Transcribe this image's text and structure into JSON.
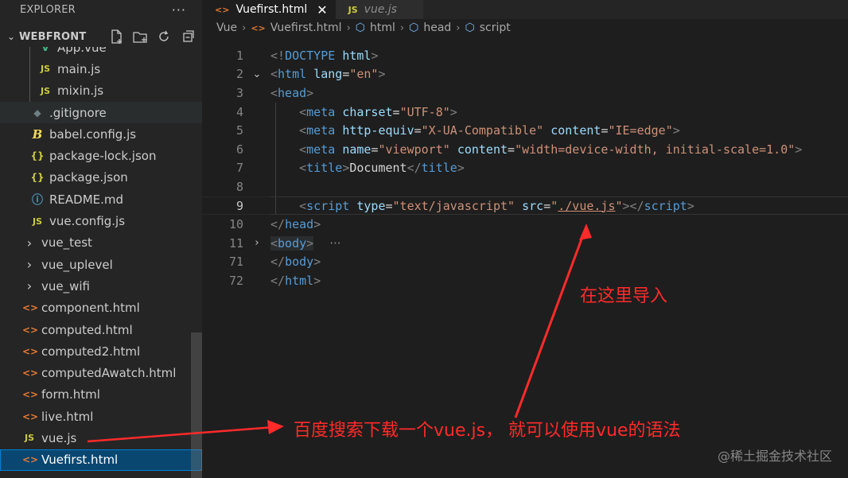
{
  "sidebar": {
    "header_title": "EXPLORER",
    "more_label": "···",
    "section_title": "WEBFRONT",
    "section_actions": [
      "new-file-icon",
      "new-folder-icon",
      "refresh-icon",
      "collapse-all-icon"
    ],
    "items": [
      {
        "label": "App.vue",
        "icon": "V",
        "kind": "vue",
        "indent": 2
      },
      {
        "label": "main.js",
        "icon": "JS",
        "kind": "js",
        "indent": 2
      },
      {
        "label": "mixin.js",
        "icon": "JS",
        "kind": "js",
        "indent": 2
      },
      {
        "label": ".gitignore",
        "icon": "◆",
        "kind": "git",
        "indent": 1
      },
      {
        "label": "babel.config.js",
        "icon": "B",
        "kind": "babel",
        "indent": 1
      },
      {
        "label": "package-lock.json",
        "icon": "{}",
        "kind": "json",
        "indent": 1
      },
      {
        "label": "package.json",
        "icon": "{}",
        "kind": "json",
        "indent": 1
      },
      {
        "label": "README.md",
        "icon": "ⓘ",
        "kind": "info",
        "indent": 1
      },
      {
        "label": "vue.config.js",
        "icon": "JS",
        "kind": "js",
        "indent": 1
      },
      {
        "label": "vue_test",
        "icon": "›",
        "kind": "folder",
        "indent": 0
      },
      {
        "label": "vue_uplevel",
        "icon": "›",
        "kind": "folder",
        "indent": 0
      },
      {
        "label": "vue_wifi",
        "icon": "›",
        "kind": "folder",
        "indent": 0
      },
      {
        "label": "component.html",
        "icon": "<>",
        "kind": "html",
        "indent": 0
      },
      {
        "label": "computed.html",
        "icon": "<>",
        "kind": "html",
        "indent": 0
      },
      {
        "label": "computed2.html",
        "icon": "<>",
        "kind": "html",
        "indent": 0
      },
      {
        "label": "computedAwatch.html",
        "icon": "<>",
        "kind": "html",
        "indent": 0
      },
      {
        "label": "form.html",
        "icon": "<>",
        "kind": "html",
        "indent": 0
      },
      {
        "label": "live.html",
        "icon": "<>",
        "kind": "html",
        "indent": 0
      },
      {
        "label": "vue.js",
        "icon": "JS",
        "kind": "js",
        "indent": 0
      },
      {
        "label": "Vuefirst.html",
        "icon": "<>",
        "kind": "html",
        "indent": 0,
        "selected": true
      }
    ]
  },
  "tabs": [
    {
      "label": "Vuefirst.html",
      "icon": "<>",
      "active": true,
      "close": "✕"
    },
    {
      "label": "vue.js",
      "icon": "JS",
      "active": false
    }
  ],
  "breadcrumb": [
    "Vue",
    "Vuefirst.html",
    "html",
    "head",
    "script"
  ],
  "code_lines": [
    {
      "num": "1",
      "fold": "",
      "tokens": [
        [
          "t-b",
          "<!"
        ],
        [
          "t-tag",
          "DOCTYPE"
        ],
        [
          "t-txt",
          " "
        ],
        [
          "t-attr",
          "html"
        ],
        [
          "t-b",
          ">"
        ]
      ]
    },
    {
      "num": "2",
      "fold": "⌄",
      "tokens": [
        [
          "t-b",
          "<"
        ],
        [
          "t-tag",
          "html"
        ],
        [
          "t-txt",
          " "
        ],
        [
          "t-attr",
          "lang"
        ],
        [
          "t-txt",
          "="
        ],
        [
          "t-str",
          "\"en\""
        ],
        [
          "t-b",
          ">"
        ]
      ]
    },
    {
      "num": "3",
      "fold": "",
      "tokens": [
        [
          "t-b",
          "<"
        ],
        [
          "t-tag",
          "head"
        ],
        [
          "t-b",
          ">"
        ]
      ]
    },
    {
      "num": "4",
      "fold": "",
      "tokens": [
        [
          "t-txt",
          "    "
        ],
        [
          "t-b",
          "<"
        ],
        [
          "t-tag",
          "meta"
        ],
        [
          "t-txt",
          " "
        ],
        [
          "t-attr",
          "charset"
        ],
        [
          "t-txt",
          "="
        ],
        [
          "t-str",
          "\"UTF-8\""
        ],
        [
          "t-b",
          ">"
        ]
      ]
    },
    {
      "num": "5",
      "fold": "",
      "tokens": [
        [
          "t-txt",
          "    "
        ],
        [
          "t-b",
          "<"
        ],
        [
          "t-tag",
          "meta"
        ],
        [
          "t-txt",
          " "
        ],
        [
          "t-attr",
          "http-equiv"
        ],
        [
          "t-txt",
          "="
        ],
        [
          "t-str",
          "\"X-UA-Compatible\""
        ],
        [
          "t-txt",
          " "
        ],
        [
          "t-attr",
          "content"
        ],
        [
          "t-txt",
          "="
        ],
        [
          "t-str",
          "\"IE=edge\""
        ],
        [
          "t-b",
          ">"
        ]
      ]
    },
    {
      "num": "6",
      "fold": "",
      "tokens": [
        [
          "t-txt",
          "    "
        ],
        [
          "t-b",
          "<"
        ],
        [
          "t-tag",
          "meta"
        ],
        [
          "t-txt",
          " "
        ],
        [
          "t-attr",
          "name"
        ],
        [
          "t-txt",
          "="
        ],
        [
          "t-str",
          "\"viewport\""
        ],
        [
          "t-txt",
          " "
        ],
        [
          "t-attr",
          "content"
        ],
        [
          "t-txt",
          "="
        ],
        [
          "t-str",
          "\"width=device-width, initial-scale=1.0\""
        ],
        [
          "t-b",
          ">"
        ]
      ]
    },
    {
      "num": "7",
      "fold": "",
      "tokens": [
        [
          "t-txt",
          "    "
        ],
        [
          "t-b",
          "<"
        ],
        [
          "t-tag",
          "title"
        ],
        [
          "t-b",
          ">"
        ],
        [
          "t-txt",
          "Document"
        ],
        [
          "t-b",
          "</"
        ],
        [
          "t-tag",
          "title"
        ],
        [
          "t-b",
          ">"
        ]
      ]
    },
    {
      "num": "8",
      "fold": "",
      "tokens": []
    },
    {
      "num": "9",
      "fold": "",
      "current": true,
      "tokens": [
        [
          "t-txt",
          "    "
        ],
        [
          "t-b",
          "<"
        ],
        [
          "t-tag",
          "script"
        ],
        [
          "t-txt",
          " "
        ],
        [
          "t-attr",
          "type"
        ],
        [
          "t-txt",
          "="
        ],
        [
          "t-str",
          "\"text/javascript\""
        ],
        [
          "t-txt",
          " "
        ],
        [
          "t-attr",
          "src"
        ],
        [
          "t-txt",
          "="
        ],
        [
          "t-str",
          "\""
        ],
        [
          "t-str u-link",
          "./vue.js"
        ],
        [
          "t-str",
          "\""
        ],
        [
          "t-b",
          "></"
        ],
        [
          "t-tag",
          "script"
        ],
        [
          "t-b",
          ">"
        ]
      ]
    },
    {
      "num": "10",
      "fold": "",
      "tokens": [
        [
          "t-b",
          "</"
        ],
        [
          "t-tag",
          "head"
        ],
        [
          "t-b",
          ">"
        ]
      ]
    },
    {
      "num": "11",
      "fold": "›",
      "tokens": [
        [
          "t-b body-hl",
          "<"
        ],
        [
          "t-tag body-hl",
          "body"
        ],
        [
          "t-b body-hl",
          ">"
        ],
        [
          "t-ell",
          "···"
        ]
      ]
    },
    {
      "num": "71",
      "fold": "",
      "tokens": [
        [
          "t-b",
          "</"
        ],
        [
          "t-tag",
          "body"
        ],
        [
          "t-b",
          ">"
        ]
      ]
    },
    {
      "num": "72",
      "fold": "",
      "tokens": [
        [
          "t-b",
          "</"
        ],
        [
          "t-tag",
          "html"
        ],
        [
          "t-b",
          ">"
        ]
      ]
    }
  ],
  "annotations": {
    "import_here": "在这里导入",
    "download_hint": "百度搜索下载一个vue.js，  就可以使用vue的语法"
  },
  "watermark": "@稀土掘金技术社区",
  "colors": {
    "annotation": "#ff2a2a",
    "selection": "#094771",
    "tag": "#569cd6",
    "attr": "#9cdcfe",
    "string": "#ce9178"
  }
}
